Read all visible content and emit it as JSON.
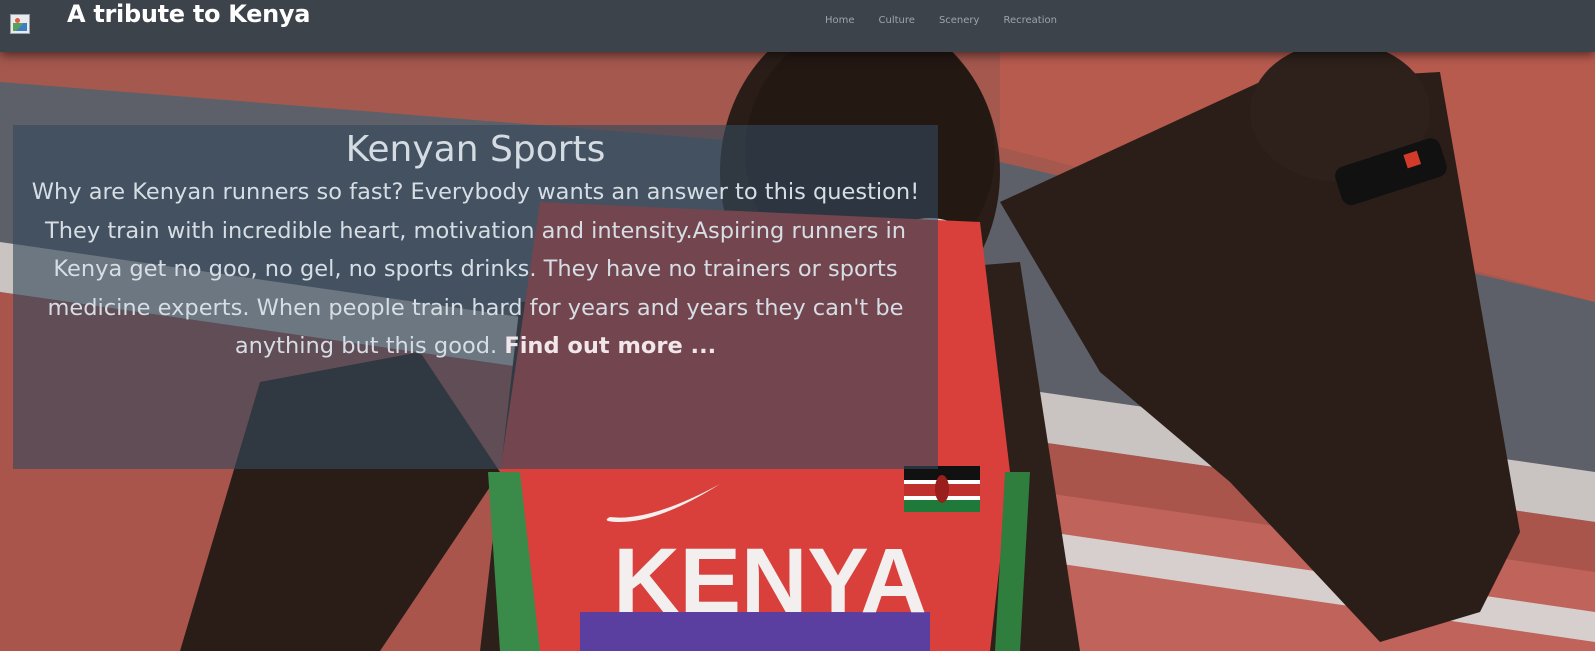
{
  "header": {
    "brand_title": "A tribute to Kenya",
    "nav": [
      {
        "label": "Home"
      },
      {
        "label": "Culture"
      },
      {
        "label": "Scenery"
      },
      {
        "label": "Recreation"
      }
    ]
  },
  "hero": {
    "heading": "Kenyan Sports",
    "body": "Why are Kenyan runners so fast? Everybody wants an answer to this question! They train with incredible heart, motivation and intensity.Aspiring runners in Kenya get no goo, no gel, no sports drinks. They have no trainers or sports medicine experts. When people train hard for years and years they can't be anything but this good.",
    "link_label": "Find out more ..."
  },
  "photo": {
    "jersey_text": "KENYA"
  },
  "colors": {
    "navbar": "#3d434b",
    "panel": "#34485c",
    "jersey": "#d9403c",
    "track": "#b8564c"
  }
}
